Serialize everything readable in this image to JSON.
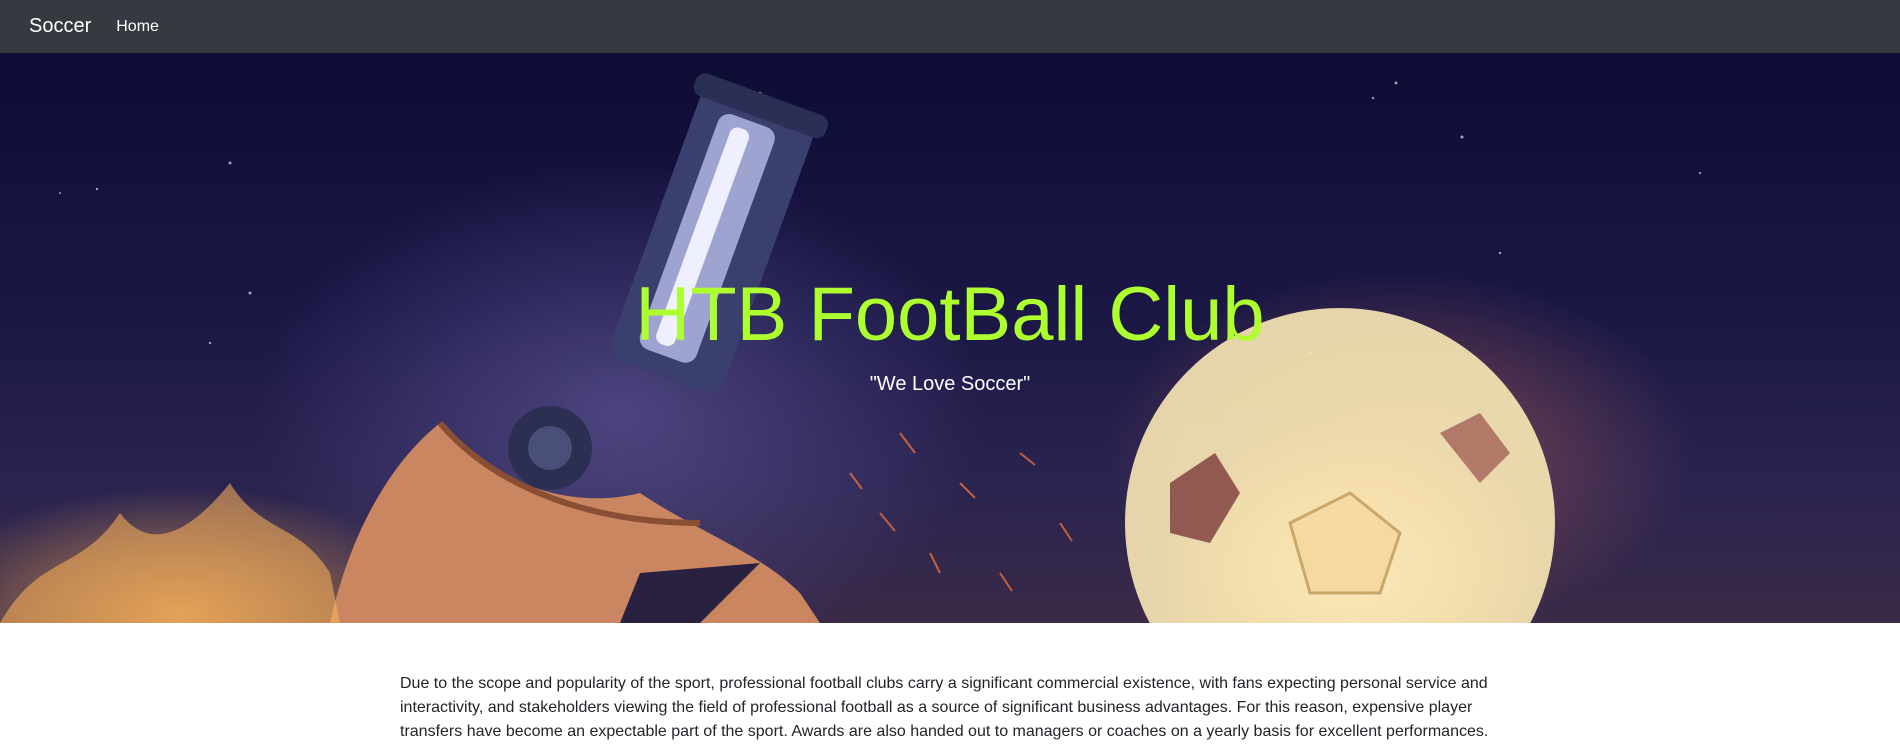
{
  "navbar": {
    "brand": "Soccer",
    "links": [
      {
        "label": "Home"
      }
    ],
    "background": "#343a40"
  },
  "hero": {
    "title": "HTB FootBall Club",
    "subtitle": "\"We Love Soccer\"",
    "title_color": "#adff2f",
    "image": "soccer-boot-and-flaming-ball"
  },
  "content": {
    "paragraph": "Due to the scope and popularity of the sport, professional football clubs carry a significant commercial existence, with fans expecting personal service and interactivity, and stakeholders viewing the field of professional football as a source of significant business advantages. For this reason, expensive player transfers have become an expectable part of the sport. Awards are also handed out to managers or coaches on a yearly basis for excellent performances."
  }
}
